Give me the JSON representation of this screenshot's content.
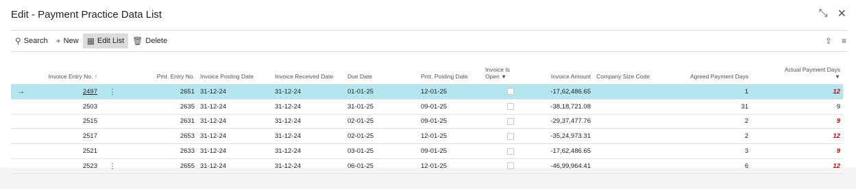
{
  "window": {
    "title": "Edit - Payment Practice Data List",
    "icons": [
      "collapse-icon",
      "close-icon"
    ]
  },
  "toolbar": {
    "search_label": "Search",
    "new_label": "New",
    "edit_list_label": "Edit List",
    "delete_label": "Delete",
    "right_icons": [
      "share-icon",
      "list-view-icon"
    ]
  },
  "table": {
    "headers": {
      "invoice_entry_no": "Invoice Entry No. ↑",
      "pmt_entry_no": "Pmt. Entry No.",
      "invoice_posting_date": "Invoice Posting Date",
      "invoice_received_date": "Invoice Received Date",
      "due_date": "Due Date",
      "pmt_posting_date": "Pmt. Posting Date",
      "invoice_is_open_1": "Invoice Is",
      "invoice_is_open_2": "Open",
      "invoice_amount": "Invoice Amount",
      "company_size_code": "Company Size Code",
      "agreed_payment_days": "Agreed Payment Days",
      "actual_payment_days": "Actual Payment Days"
    },
    "rows": [
      {
        "invoice_entry_no": "2497",
        "pmt_entry_no": "2651",
        "invoice_posting_date": "31-12-24",
        "invoice_received_date": "31-12-24",
        "due_date": "01-01-25",
        "pmt_posting_date": "12-01-25",
        "invoice_is_open": false,
        "invoice_amount": "-17,62,486.65",
        "company_size_code": "",
        "agreed_payment_days": "1",
        "actual_payment_days": "12",
        "actual_red": true,
        "selected": true
      },
      {
        "invoice_entry_no": "2503",
        "pmt_entry_no": "2635",
        "invoice_posting_date": "31-12-24",
        "invoice_received_date": "31-12-24",
        "due_date": "31-01-25",
        "pmt_posting_date": "09-01-25",
        "invoice_is_open": false,
        "invoice_amount": "-38,18,721.08",
        "company_size_code": "",
        "agreed_payment_days": "31",
        "actual_payment_days": "9",
        "actual_red": false
      },
      {
        "invoice_entry_no": "2515",
        "pmt_entry_no": "2631",
        "invoice_posting_date": "31-12-24",
        "invoice_received_date": "31-12-24",
        "due_date": "02-01-25",
        "pmt_posting_date": "09-01-25",
        "invoice_is_open": false,
        "invoice_amount": "-29,37,477.76",
        "company_size_code": "",
        "agreed_payment_days": "2",
        "actual_payment_days": "9",
        "actual_red": true
      },
      {
        "invoice_entry_no": "2517",
        "pmt_entry_no": "2653",
        "invoice_posting_date": "31-12-24",
        "invoice_received_date": "31-12-24",
        "due_date": "02-01-25",
        "pmt_posting_date": "12-01-25",
        "invoice_is_open": false,
        "invoice_amount": "-35,24,973.31",
        "company_size_code": "",
        "agreed_payment_days": "2",
        "actual_payment_days": "12",
        "actual_red": true
      },
      {
        "invoice_entry_no": "2521",
        "pmt_entry_no": "2633",
        "invoice_posting_date": "31-12-24",
        "invoice_received_date": "31-12-24",
        "due_date": "03-01-25",
        "pmt_posting_date": "09-01-25",
        "invoice_is_open": false,
        "invoice_amount": "-17,62,486.65",
        "company_size_code": "",
        "agreed_payment_days": "3",
        "actual_payment_days": "9",
        "actual_red": true
      },
      {
        "invoice_entry_no": "2523",
        "pmt_entry_no": "2655",
        "invoice_posting_date": "31-12-24",
        "invoice_received_date": "31-12-24",
        "due_date": "06-01-25",
        "pmt_posting_date": "12-01-25",
        "invoice_is_open": false,
        "invoice_amount": "-46,99,964.41",
        "company_size_code": "",
        "agreed_payment_days": "6",
        "actual_payment_days": "12",
        "actual_red": true
      }
    ]
  },
  "colors": {
    "selected_row": "#b3e6ef",
    "overdue_text": "#c00000",
    "toolbar_active": "#dcdcdc"
  }
}
